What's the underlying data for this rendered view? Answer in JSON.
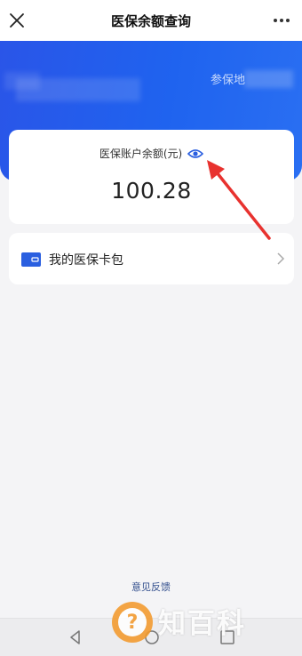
{
  "header": {
    "title": "医保余额查询"
  },
  "hero": {
    "insured_location_label": "参保地"
  },
  "balance": {
    "label": "医保账户余额(元)",
    "amount": "100.28"
  },
  "wallet": {
    "label": "我的医保卡包"
  },
  "footer": {
    "feedback_label": "意见反馈"
  },
  "watermark": {
    "icon_glyph": "?",
    "text": "知百科"
  },
  "colors": {
    "brand_blue": "#1f63ef",
    "annotation_arrow": "#e8322f",
    "watermark_orange": "#f39a2c"
  }
}
